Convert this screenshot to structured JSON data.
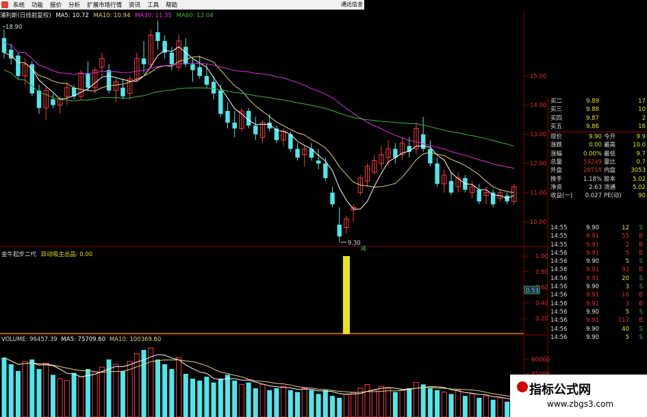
{
  "menu": {
    "items": [
      "系统",
      "功能",
      "报价",
      "分析",
      "扩展市场行情",
      "资讯",
      "工具",
      "帮助"
    ],
    "right_text": "通达信金"
  },
  "legend": {
    "name": "浦利斯(日线前复权)",
    "ma5": "MA5: 10.72",
    "ma10": "MA10: 10.94",
    "ma30": "MA30: 11.35",
    "ma60": "MA60: 12.04",
    "high_label": "18.90",
    "low_label": "9.30",
    "low_marker": "减"
  },
  "price_axis": {
    "ticks": [
      "15.00",
      "14.00",
      "13.00",
      "12.00",
      "11.00",
      "10.00"
    ]
  },
  "indicator": {
    "title": "金牛起步二代",
    "signal_label": "异动吸主出品: 0.00",
    "ticks": [
      "1.00",
      "0.80",
      "0.60",
      "0.40",
      "0.20"
    ],
    "current_tag": "0.53"
  },
  "volume": {
    "label": "VOLUME: 96457.39",
    "ma5": "MA5: 75709.60",
    "ma10": "MA10: 100369.60",
    "ticks": [
      "60000",
      "45000"
    ]
  },
  "orderbook": {
    "levels": [
      {
        "name": "买二",
        "price": "9.89",
        "vol": "17"
      },
      {
        "name": "买三",
        "price": "9.88",
        "vol": "10"
      },
      {
        "name": "买四",
        "price": "9.87",
        "vol": "2"
      },
      {
        "name": "买五",
        "price": "9.86",
        "vol": "16"
      }
    ],
    "stats": [
      {
        "l1": "现价",
        "v1": "9.90",
        "l2": "今开",
        "v2": "9.9"
      },
      {
        "l1": "涨跌",
        "v1": "0.00",
        "l2": "最高",
        "v2": "10.0"
      },
      {
        "l1": "涨幅",
        "v1": "0.00%",
        "l2": "最低",
        "v2": "9.7"
      },
      {
        "l1": "总量",
        "v1": "59249",
        "l2": "量比",
        "v2": "0.7"
      },
      {
        "l1": "外盘",
        "v1": "28718",
        "l2": "内盘",
        "v2": "3053"
      },
      {
        "l1": "换手",
        "v1": "1.18%",
        "l2": "股本",
        "v2": "5.02"
      },
      {
        "l1": "净资",
        "v1": "2.63",
        "l2": "流通",
        "v2": "5.02"
      },
      {
        "l1": "收益(一)",
        "v1": "0.027",
        "l2": "PE(动)",
        "v2": "90"
      }
    ]
  },
  "trades": [
    {
      "t": "14:55",
      "p": "9.90",
      "v": "12",
      "d": "S"
    },
    {
      "t": "14:55",
      "p": "9.91",
      "v": "55",
      "d": "B"
    },
    {
      "t": "14:55",
      "p": "9.91",
      "v": "2",
      "d": "B"
    },
    {
      "t": "14:56",
      "p": "9.91",
      "v": "5",
      "d": "B"
    },
    {
      "t": "14:56",
      "p": "9.90",
      "v": "5",
      "d": "S"
    },
    {
      "t": "14:56",
      "p": "9.91",
      "v": "93",
      "d": "B"
    },
    {
      "t": "14:56",
      "p": "9.91",
      "v": "20",
      "d": "S"
    },
    {
      "t": "14:56",
      "p": "9.90",
      "v": "3",
      "d": "S"
    },
    {
      "t": "14:56",
      "p": "9.91",
      "v": "16",
      "d": "B"
    },
    {
      "t": "14:56",
      "p": "9.91",
      "v": "3",
      "d": "B"
    },
    {
      "t": "14:56",
      "p": "9.90",
      "v": "5",
      "d": "S"
    },
    {
      "t": "14:56",
      "p": "9.91",
      "v": "117",
      "d": "B"
    },
    {
      "t": "14:56",
      "p": "9.90",
      "v": "40",
      "d": "S"
    },
    {
      "t": "14:56",
      "p": "9.90",
      "v": "5",
      "d": "S"
    }
  ],
  "watermark": {
    "title": "指标公式网",
    "url": "www.zbgs3.com"
  },
  "colors": {
    "up": "#ff3b3b",
    "down": "#4fe7ec",
    "ma5": "#ffffff",
    "ma10": "#e8d27a",
    "ma30": "#e02fe0",
    "ma60": "#3db83d",
    "signal": "#e5e51e",
    "grid": "#8b0000"
  },
  "chart_data": {
    "type": "candlestick",
    "ohlc": [
      [
        16.3,
        16.6,
        15.6,
        15.8
      ],
      [
        15.9,
        16.1,
        15.4,
        15.6
      ],
      [
        15.7,
        15.8,
        14.9,
        15.0
      ],
      [
        15.0,
        15.6,
        14.7,
        15.4
      ],
      [
        15.4,
        15.5,
        14.3,
        14.4
      ],
      [
        14.5,
        14.7,
        13.7,
        13.9
      ],
      [
        13.9,
        14.6,
        13.5,
        14.5
      ],
      [
        14.2,
        14.4,
        13.9,
        14.0
      ],
      [
        14.0,
        14.3,
        13.7,
        14.2
      ],
      [
        14.3,
        14.8,
        14.0,
        14.6
      ],
      [
        14.6,
        14.7,
        14.2,
        14.3
      ],
      [
        14.3,
        15.2,
        14.2,
        15.1
      ],
      [
        15.1,
        15.5,
        14.5,
        14.6
      ],
      [
        14.6,
        15.3,
        14.4,
        15.2
      ],
      [
        15.3,
        15.8,
        15.0,
        15.6
      ],
      [
        15.2,
        15.4,
        14.4,
        14.5
      ],
      [
        14.5,
        14.9,
        14.1,
        14.8
      ],
      [
        14.6,
        14.9,
        14.2,
        14.3
      ],
      [
        14.4,
        15.0,
        14.2,
        14.9
      ],
      [
        14.9,
        15.8,
        14.8,
        15.6
      ],
      [
        15.6,
        16.2,
        15.1,
        15.4
      ],
      [
        15.4,
        16.6,
        15.3,
        16.4
      ],
      [
        16.5,
        16.9,
        15.9,
        16.2
      ],
      [
        16.2,
        16.4,
        15.6,
        15.8
      ],
      [
        15.8,
        16.0,
        15.2,
        15.4
      ],
      [
        15.3,
        16.4,
        15.2,
        16.2
      ],
      [
        16.0,
        16.3,
        15.3,
        15.4
      ],
      [
        15.4,
        15.6,
        14.8,
        15.2
      ],
      [
        15.3,
        15.7,
        14.9,
        15.0
      ],
      [
        15.0,
        15.4,
        14.6,
        14.7
      ],
      [
        14.8,
        15.0,
        14.2,
        14.4
      ],
      [
        14.5,
        14.7,
        13.6,
        13.7
      ],
      [
        13.8,
        14.1,
        13.2,
        13.4
      ],
      [
        13.4,
        13.8,
        12.9,
        13.2
      ],
      [
        13.2,
        13.9,
        13.1,
        13.8
      ],
      [
        13.8,
        13.9,
        13.2,
        13.3
      ],
      [
        13.3,
        13.6,
        12.8,
        13.0
      ],
      [
        12.9,
        13.5,
        12.7,
        13.4
      ],
      [
        13.4,
        13.7,
        13.1,
        13.2
      ],
      [
        13.2,
        13.3,
        12.7,
        12.8
      ],
      [
        12.8,
        13.2,
        12.6,
        13.1
      ],
      [
        13.0,
        13.1,
        12.4,
        12.5
      ],
      [
        12.5,
        12.7,
        12.1,
        12.2
      ],
      [
        12.3,
        12.6,
        11.9,
        12.5
      ],
      [
        12.5,
        12.7,
        12.1,
        12.2
      ],
      [
        12.1,
        12.5,
        11.8,
        12.0
      ],
      [
        12.0,
        12.2,
        11.4,
        11.5
      ],
      [
        11.0,
        11.2,
        10.5,
        10.6
      ],
      [
        9.9,
        10.5,
        9.3,
        9.5
      ],
      [
        9.8,
        10.2,
        9.6,
        10.1
      ],
      [
        10.4,
        10.6,
        10.0,
        10.5
      ],
      [
        11.0,
        11.6,
        10.9,
        11.5
      ],
      [
        11.4,
        12.0,
        11.2,
        11.9
      ],
      [
        11.7,
        12.3,
        11.6,
        12.1
      ],
      [
        12.0,
        12.6,
        11.8,
        12.3
      ],
      [
        12.2,
        12.8,
        11.9,
        12.5
      ],
      [
        12.5,
        12.7,
        12.0,
        12.2
      ],
      [
        12.3,
        12.9,
        12.1,
        12.7
      ],
      [
        12.6,
        12.9,
        12.2,
        12.4
      ],
      [
        12.5,
        13.4,
        12.3,
        13.2
      ],
      [
        13.0,
        13.6,
        12.4,
        12.5
      ],
      [
        12.5,
        12.8,
        11.9,
        12.0
      ],
      [
        12.0,
        12.2,
        11.2,
        11.3
      ],
      [
        11.3,
        11.8,
        11.0,
        11.6
      ],
      [
        11.4,
        11.7,
        10.9,
        11.0
      ],
      [
        11.2,
        11.7,
        11.0,
        11.5
      ],
      [
        11.5,
        11.6,
        11.0,
        11.1
      ],
      [
        11.0,
        11.4,
        10.8,
        11.2
      ],
      [
        11.1,
        11.3,
        10.6,
        10.7
      ],
      [
        10.9,
        11.2,
        10.6,
        11.0
      ],
      [
        11.0,
        11.1,
        10.5,
        10.6
      ],
      [
        10.8,
        11.1,
        10.7,
        11.0
      ],
      [
        10.9,
        11.0,
        10.6,
        10.7
      ],
      [
        10.7,
        11.3,
        10.6,
        11.2
      ]
    ],
    "volume": [
      62,
      55,
      48,
      58,
      60,
      50,
      56,
      44,
      40,
      38,
      46,
      42,
      50,
      47,
      52,
      60,
      55,
      48,
      58,
      66,
      70,
      72,
      60,
      55,
      50,
      62,
      45,
      40,
      38,
      42,
      36,
      40,
      44,
      38,
      34,
      36,
      30,
      34,
      28,
      30,
      32,
      28,
      26,
      30,
      28,
      24,
      28,
      22,
      20,
      24,
      26,
      30,
      34,
      28,
      32,
      30,
      26,
      28,
      30,
      36,
      34,
      30,
      28,
      26,
      24,
      28,
      22,
      24,
      20,
      22,
      18,
      20,
      16,
      18
    ],
    "indicator_signal": {
      "index": 49,
      "value": 1.0
    },
    "price_range": [
      9.2,
      16.9
    ],
    "volume_range": [
      0,
      75
    ]
  }
}
